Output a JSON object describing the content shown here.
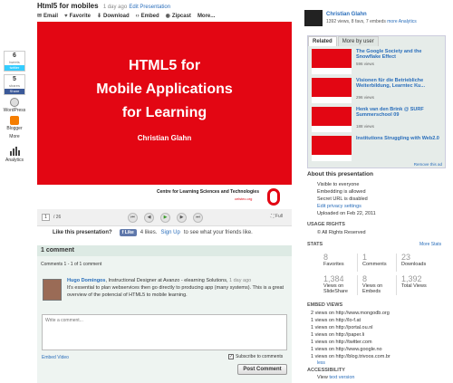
{
  "header": {
    "title": "Html5 for mobiles",
    "time_ago": "1 day ago",
    "edit_label": "Edit Presentation"
  },
  "toolbar": {
    "email": "Email",
    "favorite": "Favorite",
    "download": "Download",
    "embed": "Embed",
    "zipcast": "Zipcast",
    "more": "More..."
  },
  "share_bar": {
    "tweets_count": "6",
    "tweets_label": "tweets",
    "twitter_label": "twitter",
    "shares_count": "5",
    "shares_label": "shares",
    "share_label": "Share",
    "wordpress_label": "WordPress",
    "blogger_label": "Blogger",
    "more_label": "More",
    "analytics_label": "Analytics"
  },
  "slide": {
    "line1": "HTML5 for",
    "line2": "Mobile Applications",
    "line3": "for Learning",
    "author": "Christian Glahn",
    "footer_org": "Centre for Learning Sciences and Technologies",
    "footer_site": "celstec.org"
  },
  "player": {
    "page_value": "1",
    "page_total": "/ 26",
    "full_label": "Full"
  },
  "like": {
    "question": "Like this presentation?",
    "button_label": "Like",
    "count_text": "4 likes.",
    "signup_link": "Sign Up",
    "signup_rest": "to see what your friends like."
  },
  "comments": {
    "header": "1 comment",
    "count_text": "Comments 1 - 1 of 1 comment",
    "item": {
      "author": "Hugo Domingos",
      "role": ", Instructional Designer at Avanzo - elearning Solutions, ",
      "time": "1 day ago",
      "text": "It's essential to plan webservices then go directly to producing app (many systems). This is a great overview of the potencial of HTML5 to mobile learning."
    },
    "input_placeholder": "Write a comment...",
    "embed_video": "Embed Video",
    "subscribe_label": "Subscribe to comments",
    "post_button": "Post Comment"
  },
  "author_panel": {
    "name": "Christian Glahn",
    "stats": "1392 views, 8 favs, 7 embeds",
    "more_label": "more",
    "analytics_link": "Analytics"
  },
  "related": {
    "tabs": [
      "Related",
      "More by user"
    ],
    "items": [
      {
        "title": "The Google Society and the Snowflake Effect",
        "views": "596 views"
      },
      {
        "title": "Visionen für die Betriebliche Weiterbildung, Learntec Ku...",
        "views": "296 views"
      },
      {
        "title": "Henk van den Brink @ SURF Summerschool 09",
        "views": "188 views"
      },
      {
        "title": "Institutions Struggling with Web2.0",
        "views": ""
      }
    ],
    "remove_ad": "Remove this ad"
  },
  "about": {
    "header": "About this presentation",
    "lines": [
      "Visible to everyone",
      "Embedding is allowed",
      "Secret URL is disabled"
    ],
    "privacy_link": "Edit privacy settings",
    "uploaded": "Uploaded on Feb 22, 2011"
  },
  "usage_rights": {
    "header": "USAGE RIGHTS",
    "value": "© All Rights Reserved"
  },
  "stats": {
    "header": "STATS",
    "more_link": "More Stats",
    "row1": [
      {
        "num": "8",
        "cap": "Favorites"
      },
      {
        "num": "1",
        "cap": "Comments"
      },
      {
        "num": "23",
        "cap": "Downloads"
      }
    ],
    "row2": [
      {
        "num": "1,384",
        "cap": "Views on SlideShare"
      },
      {
        "num": "8",
        "cap": "Views on Embeds"
      },
      {
        "num": "1,392",
        "cap": "Total Views"
      }
    ]
  },
  "embed_views": {
    "header": "EMBED VIEWS",
    "rows": [
      "2 views on http://www.mongodb.org",
      "1 views on http://lo-f.at",
      "1 views on http://portal.ou.nl",
      "1 views on http://paper.li",
      "1 views on http://twitter.com",
      "1 views on http://www.google.no",
      "1 views on http://blog.trivoos.com.br"
    ],
    "less_link": "less"
  },
  "accessibility": {
    "header": "ACCESSIBILITY",
    "view_label": "View",
    "text_version_link": "text version"
  }
}
